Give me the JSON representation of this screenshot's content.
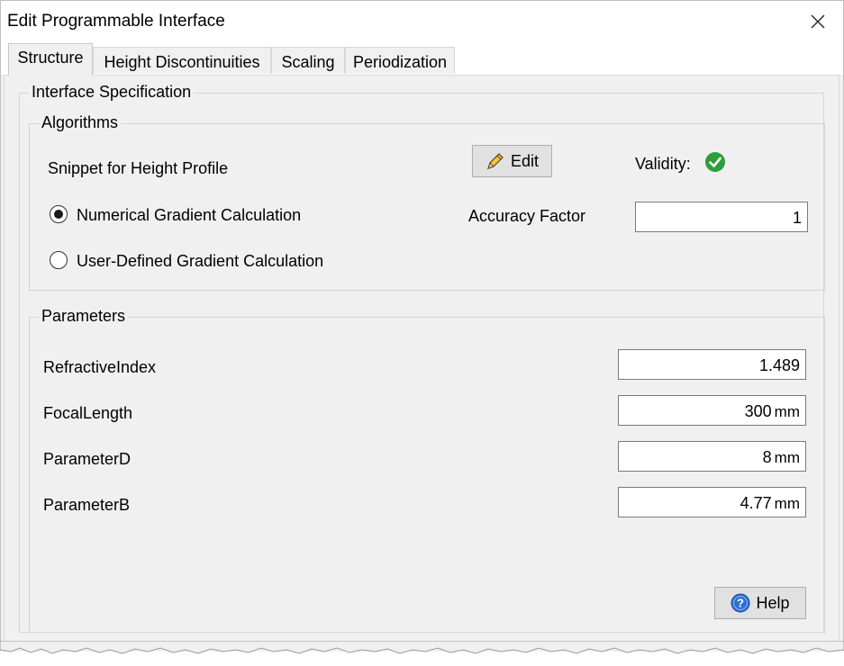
{
  "window": {
    "title": "Edit Programmable Interface"
  },
  "tabs": [
    {
      "label": "Structure",
      "active": true
    },
    {
      "label": "Height Discontinuities",
      "active": false
    },
    {
      "label": "Scaling",
      "active": false
    },
    {
      "label": "Periodization",
      "active": false
    }
  ],
  "interface_spec": {
    "group_label": "Interface Specification",
    "algorithms": {
      "group_label": "Algorithms",
      "snippet_label": "Snippet for Height Profile",
      "edit_button": "Edit",
      "validity_label": "Validity:",
      "validity_icon": "checkmark-circle-icon",
      "validity_color": "#2e9e3a",
      "radio_numerical": "Numerical Gradient Calculation",
      "radio_user_defined": "User-Defined Gradient Calculation",
      "selected_option": "Numerical Gradient Calculation",
      "accuracy_label": "Accuracy Factor",
      "accuracy_value": "1"
    },
    "parameters": {
      "group_label": "Parameters",
      "rows": [
        {
          "name": "RefractiveIndex",
          "value": "1.489",
          "unit": ""
        },
        {
          "name": "FocalLength",
          "value": "300",
          "unit": "mm"
        },
        {
          "name": "ParameterD",
          "value": "8",
          "unit": "mm"
        },
        {
          "name": "ParameterB",
          "value": "4.77",
          "unit": "mm"
        }
      ]
    }
  },
  "help_button": "Help"
}
